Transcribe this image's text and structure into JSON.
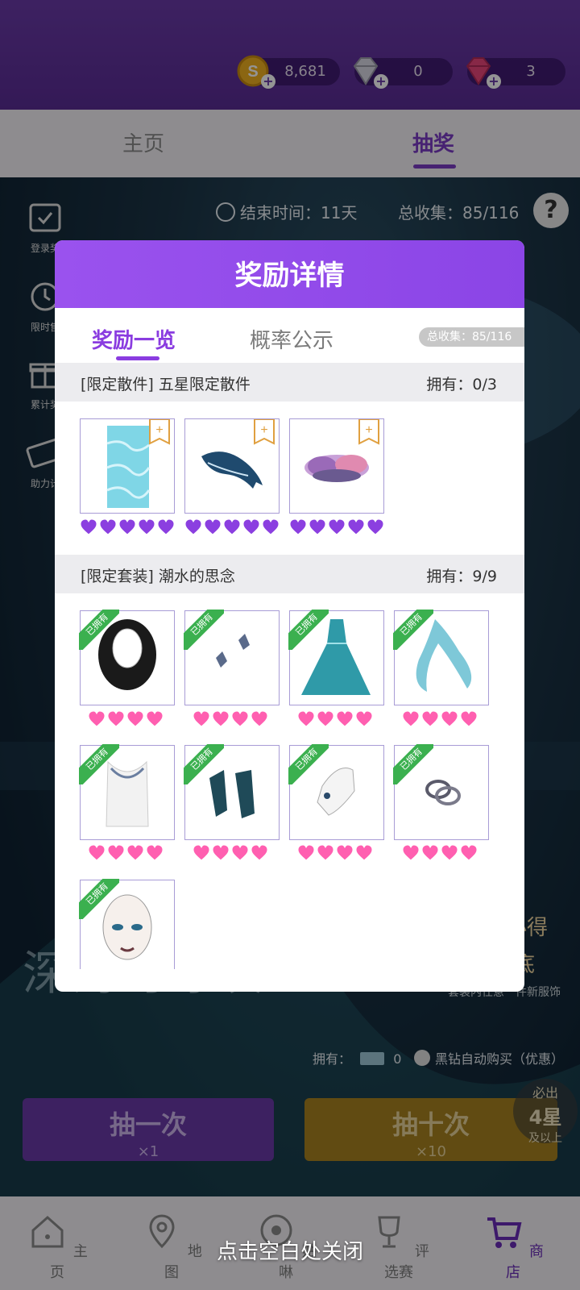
{
  "currencies": [
    {
      "id": "gold",
      "amount": "8,681",
      "color": "#f0b020"
    },
    {
      "id": "diamond",
      "amount": "0",
      "color": "#c9c9d6"
    },
    {
      "id": "pink_diamond",
      "amount": "3",
      "color": "#e8467a"
    }
  ],
  "tabs": {
    "home": "主页",
    "draw": "抽奖"
  },
  "info": {
    "end_time": "结束时间：11天",
    "total": "总收集：85/116",
    "help": "?"
  },
  "side_items": [
    "登录奖",
    "限时售",
    "累计奖",
    "助力计"
  ],
  "scene": {
    "title": "深海时呼唤",
    "tag1": "必得",
    "tag2": "海底",
    "tag3": "套装内任意一件新服饰",
    "owned_label": "拥有：",
    "owned_value": "0",
    "auto_buy": "黑钻自动购买（优惠）",
    "draw_one": "抽一次",
    "draw_one_count": "×1",
    "draw_ten": "抽十次",
    "draw_ten_count": "×10",
    "guarantee_line1": "必出",
    "guarantee_line2": "4星",
    "guarantee_line3": "及以上"
  },
  "bottom_nav": [
    {
      "id": "home",
      "label": "主页",
      "icon": "house-icon",
      "active": false
    },
    {
      "id": "map",
      "label": "地图",
      "icon": "map-pin-icon",
      "active": false
    },
    {
      "id": "posts",
      "label": "贴啉",
      "icon": "chat-icon",
      "active": false
    },
    {
      "id": "contest",
      "label": "评选赛",
      "icon": "trophy-icon",
      "active": false
    },
    {
      "id": "shop",
      "label": "商店",
      "icon": "cart-icon",
      "active": true
    }
  ],
  "close_hint": "点击空白处关闭",
  "modal": {
    "title": "奖励详情",
    "tab_overview": "奖励一览",
    "tab_probability": "概率公示",
    "pill": "总收集：85/116",
    "sections": [
      {
        "title": "[限定散件] 五星限定散件",
        "owned": "拥有：0/3",
        "items": [
          {
            "name": "water-tile-item",
            "owned": false,
            "stars": 5,
            "color": "#8b3fe0"
          },
          {
            "name": "whale-item",
            "owned": false,
            "stars": 5,
            "color": "#8b3fe0"
          },
          {
            "name": "coral-item",
            "owned": false,
            "stars": 5,
            "color": "#8b3fe0"
          }
        ]
      },
      {
        "title": "[限定套装] 潮水的思念",
        "owned": "拥有：9/9",
        "items": [
          {
            "name": "curly-hair-item",
            "owned": true,
            "stars": 4,
            "color": "#ff5fb0"
          },
          {
            "name": "earrings-item",
            "owned": true,
            "stars": 4,
            "color": "#ff5fb0"
          },
          {
            "name": "gown-item",
            "owned": true,
            "stars": 4,
            "color": "#ff5fb0"
          },
          {
            "name": "veil-item",
            "owned": true,
            "stars": 4,
            "color": "#ff5fb0"
          },
          {
            "name": "necklace-item",
            "owned": true,
            "stars": 4,
            "color": "#ff5fb0"
          },
          {
            "name": "heels-item",
            "owned": true,
            "stars": 4,
            "color": "#ff5fb0"
          },
          {
            "name": "glove-item",
            "owned": true,
            "stars": 4,
            "color": "#ff5fb0"
          },
          {
            "name": "bracelet-item",
            "owned": true,
            "stars": 4,
            "color": "#ff5fb0"
          },
          {
            "name": "makeup-item",
            "owned": true,
            "stars": 4,
            "color": "#ff5fb0"
          }
        ]
      }
    ],
    "owned_badge": "已拥有"
  }
}
